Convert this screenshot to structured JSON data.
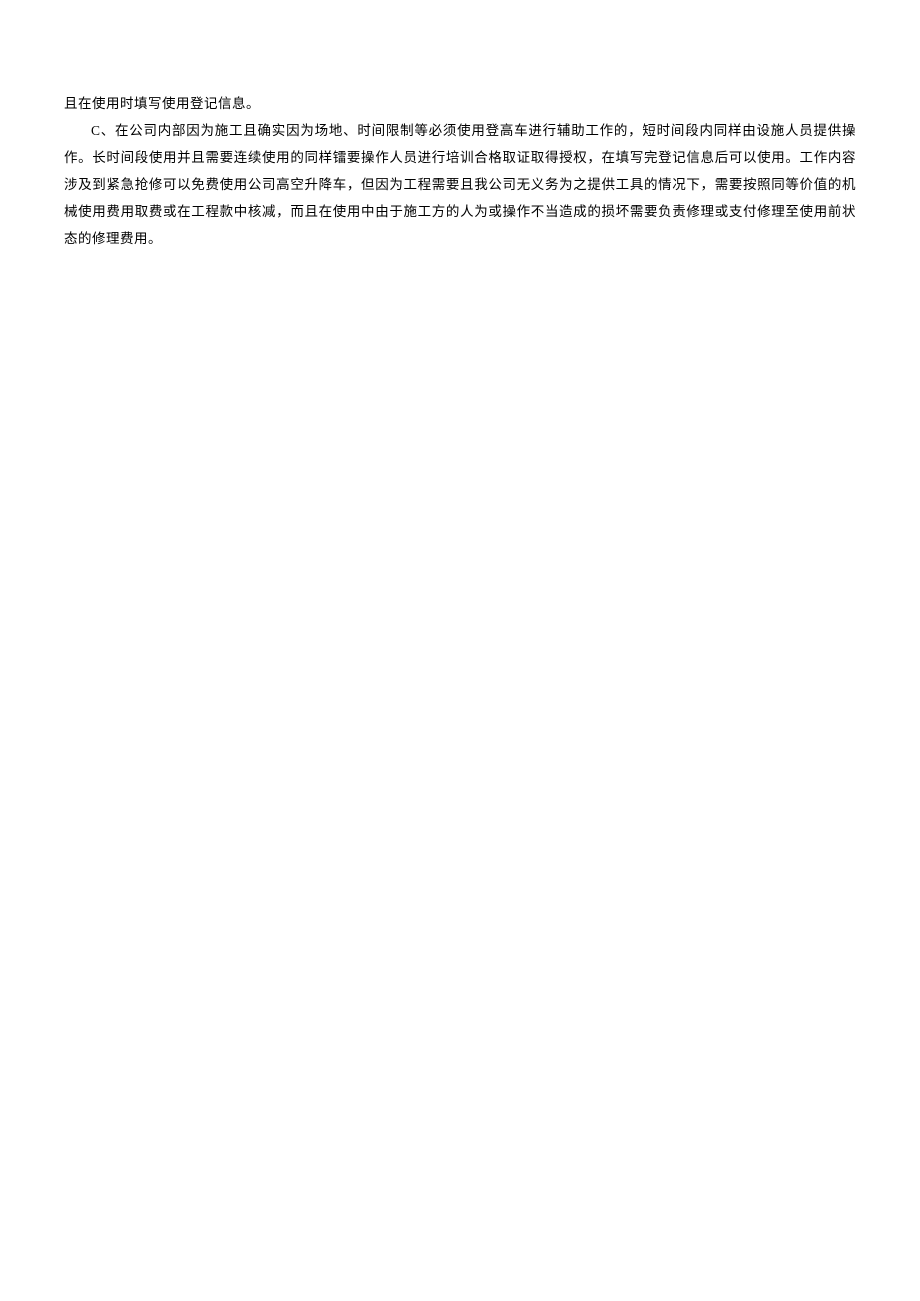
{
  "document": {
    "paragraphs": [
      {
        "text": "且在使用时填写使用登记信息。",
        "indented": false
      },
      {
        "text": "C、在公司内部因为施工且确实因为场地、时间限制等必须使用登高车进行辅助工作的，短时间段内同样由设施人员提供操作。长时间段使用并且需要连续使用的同样镭要操作人员进行培训合格取证取得授权，在填写完登记信息后可以使用。工作内容涉及到紧急抢修可以免费使用公司高空升降车，但因为工程需要且我公司无义务为之提供工具的情况下，需要按照同等价值的机械使用费用取费或在工程款中核减，而且在使用中由于施工方的人为或操作不当造成的损坏需要负责修理或支付修理至使用前状态的修理费用。",
        "indented": true
      }
    ]
  }
}
